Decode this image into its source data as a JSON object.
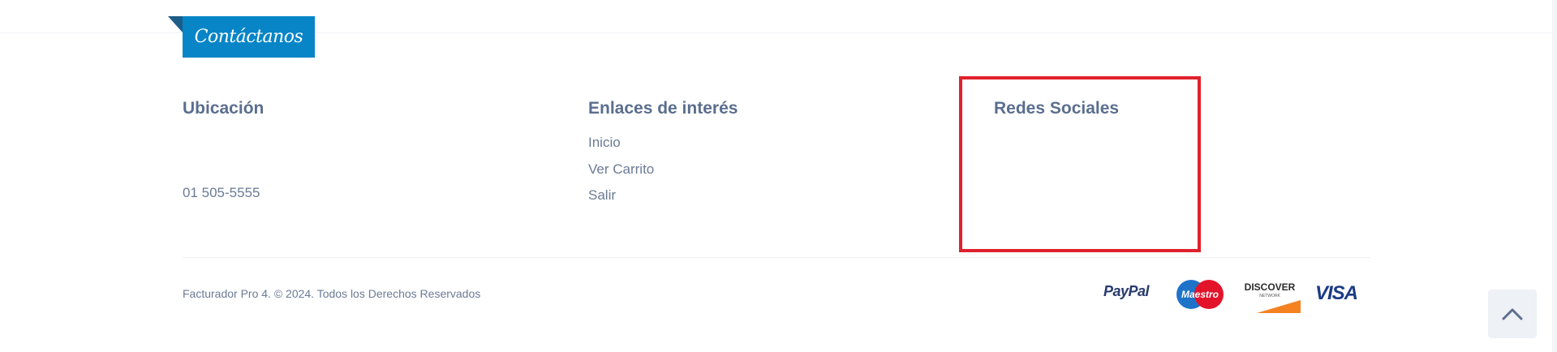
{
  "header": {
    "tab_label": "Contáctanos"
  },
  "footer": {
    "location": {
      "title": "Ubicación",
      "phone": "01 505-5555"
    },
    "links": {
      "title": "Enlaces de interés",
      "items": [
        "Inicio",
        "Ver Carrito",
        "Salir"
      ]
    },
    "social": {
      "title": "Redes Sociales"
    },
    "copyright": "Facturador Pro 4. © 2024. Todos los Derechos Reservados",
    "payments": {
      "paypal": "PayPal",
      "maestro": "Maestro",
      "discover": "DISCOVER",
      "discover_sub": "NETWORK",
      "visa": "VISA"
    }
  },
  "colors": {
    "tab_bg": "#0785c7",
    "highlight_border": "#e0212b",
    "heading": "#5b6e8f",
    "text": "#6b7b95"
  },
  "icons": {
    "scroll_top": "chevron-up-icon"
  }
}
